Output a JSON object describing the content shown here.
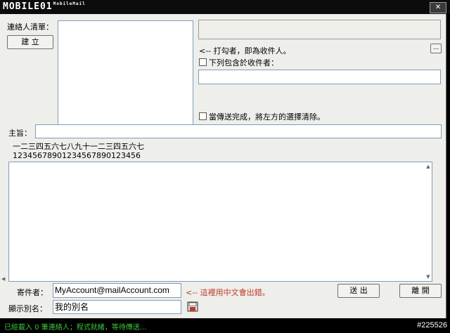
{
  "app": {
    "logo_text": "MOBILE01",
    "logo_sub": "MobileMail"
  },
  "window": {
    "close_glyph": "✕"
  },
  "contacts": {
    "label": "連絡人清單：",
    "create_button": "建 立"
  },
  "recipients": {
    "hint": "<-- 打勾者，即為收件人。",
    "browse_button": "...",
    "include_checkbox_label": "下列包含於收件者：",
    "clear_checkbox_label": "當傳送完成，將左方的選擇清除。"
  },
  "subject": {
    "label": "主旨：",
    "value": ""
  },
  "counter": {
    "line1": "一二三四五六七八九十一二三四五六七",
    "line2": "12345678901234567890123456"
  },
  "sender": {
    "label": "寄件者：",
    "value": "MyAccount@mailAccount.com",
    "warning": "<-- 這裡用中文會出錯。",
    "alias_label": "顯示別名：",
    "alias_value": "我的別名"
  },
  "actions": {
    "send": "送 出",
    "exit": "離 開"
  },
  "status": {
    "text": "已經載入 0 筆連絡人；程式就緒，等待傳送...",
    "code": "#225526"
  },
  "colors": {
    "window_bg": "#eeeeea",
    "status_text": "#3ac53a",
    "warning": "#c0392b"
  }
}
